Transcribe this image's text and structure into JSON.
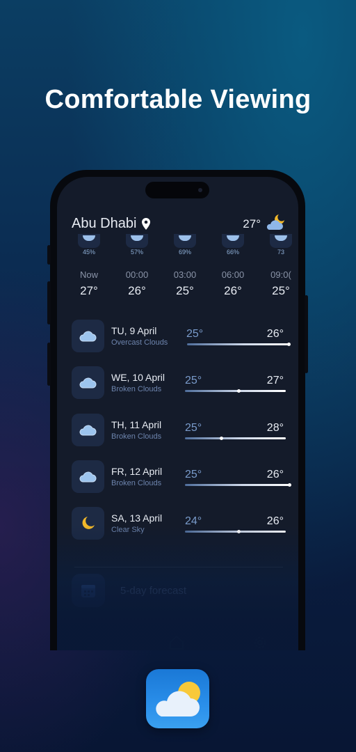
{
  "headline": "Comfortable Viewing",
  "header": {
    "city": "Abu Dhabi",
    "current_temp": "27°",
    "icon": "partly-cloudy-night-icon"
  },
  "hourly": [
    {
      "pct": "45%",
      "time": "Now",
      "temp": "27°"
    },
    {
      "pct": "57%",
      "time": "00:00",
      "temp": "26°"
    },
    {
      "pct": "69%",
      "time": "03:00",
      "temp": "25°"
    },
    {
      "pct": "66%",
      "time": "06:00",
      "temp": "26°"
    },
    {
      "pct": "73",
      "time": "09:0(",
      "temp": "25°"
    }
  ],
  "daily": [
    {
      "date": "TU, 9 April",
      "desc": "Overcast Clouds",
      "lo": "25°",
      "hi": "26°",
      "icon": "cloud-icon"
    },
    {
      "date": "WE, 10 April",
      "desc": "Broken Clouds",
      "lo": "25°",
      "hi": "27°",
      "icon": "cloud-icon"
    },
    {
      "date": "TH, 11 April",
      "desc": "Broken Clouds",
      "lo": "25°",
      "hi": "28°",
      "icon": "cloud-icon"
    },
    {
      "date": "FR, 12 April",
      "desc": "Broken Clouds",
      "lo": "25°",
      "hi": "26°",
      "icon": "cloud-icon"
    },
    {
      "date": "SA, 13 April",
      "desc": "Clear Sky",
      "lo": "24°",
      "hi": "26°",
      "icon": "moon-icon"
    }
  ],
  "forecast_button": {
    "label": "5-day forecast",
    "icon": "calendar-icon"
  },
  "tab_bar": [
    {
      "icon": "home-icon"
    },
    {
      "icon": "settings-icon"
    }
  ],
  "app_icon": {
    "icon": "sun-cloud-icon"
  },
  "colors": {
    "accent": "#2a8fea",
    "screen_bg": "#141b2a",
    "tile_bg": "#1d2a44"
  }
}
